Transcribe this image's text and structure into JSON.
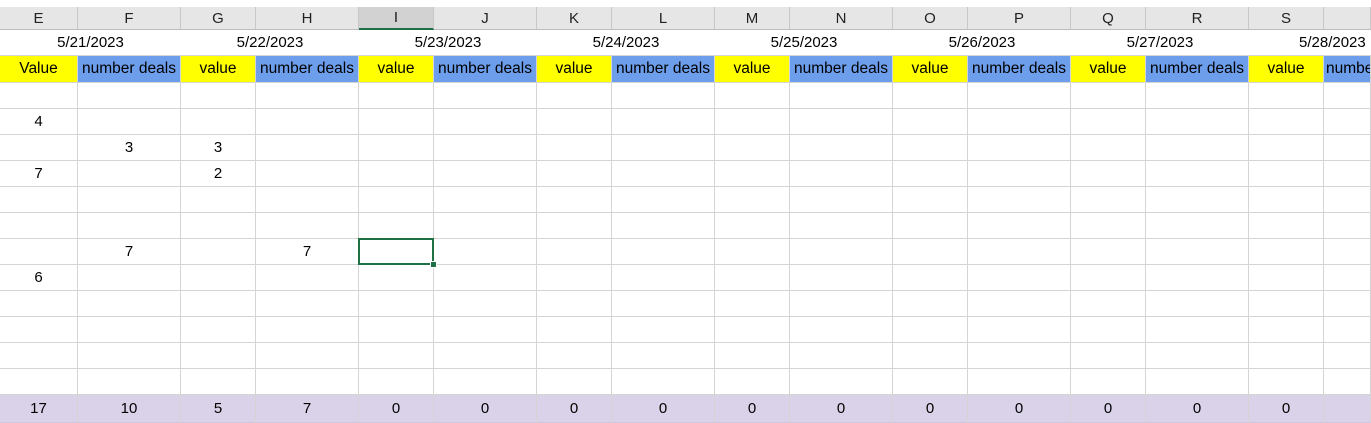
{
  "columns": [
    "E",
    "F",
    "G",
    "H",
    "I",
    "J",
    "K",
    "L",
    "M",
    "N",
    "O",
    "P",
    "Q",
    "R",
    "S",
    ""
  ],
  "active_column": "I",
  "dates": [
    "5/21/2023",
    "5/22/2023",
    "5/23/2023",
    "5/24/2023",
    "5/25/2023",
    "5/26/2023",
    "5/27/2023",
    "5/28/2023"
  ],
  "labels": [
    "Value",
    "number deals",
    "value",
    "number deals",
    "value",
    "number deals",
    "value",
    "number deals",
    "value",
    "number deals",
    "value",
    "number deals",
    "value",
    "number deals",
    "value",
    "number deals"
  ],
  "data_rows": [
    [
      "",
      "",
      "",
      "",
      "",
      "",
      "",
      "",
      "",
      "",
      "",
      "",
      "",
      "",
      "",
      ""
    ],
    [
      "4",
      "",
      "",
      "",
      "",
      "",
      "",
      "",
      "",
      "",
      "",
      "",
      "",
      "",
      "",
      ""
    ],
    [
      "",
      "3",
      "3",
      "",
      "",
      "",
      "",
      "",
      "",
      "",
      "",
      "",
      "",
      "",
      "",
      ""
    ],
    [
      "7",
      "",
      "2",
      "",
      "",
      "",
      "",
      "",
      "",
      "",
      "",
      "",
      "",
      "",
      "",
      ""
    ],
    [
      "",
      "",
      "",
      "",
      "",
      "",
      "",
      "",
      "",
      "",
      "",
      "",
      "",
      "",
      "",
      ""
    ],
    [
      "",
      "",
      "",
      "",
      "",
      "",
      "",
      "",
      "",
      "",
      "",
      "",
      "",
      "",
      "",
      ""
    ],
    [
      "",
      "7",
      "",
      "7",
      "",
      "",
      "",
      "",
      "",
      "",
      "",
      "",
      "",
      "",
      "",
      ""
    ],
    [
      "6",
      "",
      "",
      "",
      "",
      "",
      "",
      "",
      "",
      "",
      "",
      "",
      "",
      "",
      "",
      ""
    ],
    [
      "",
      "",
      "",
      "",
      "",
      "",
      "",
      "",
      "",
      "",
      "",
      "",
      "",
      "",
      "",
      ""
    ],
    [
      "",
      "",
      "",
      "",
      "",
      "",
      "",
      "",
      "",
      "",
      "",
      "",
      "",
      "",
      "",
      ""
    ],
    [
      "",
      "",
      "",
      "",
      "",
      "",
      "",
      "",
      "",
      "",
      "",
      "",
      "",
      "",
      "",
      ""
    ],
    [
      "",
      "",
      "",
      "",
      "",
      "",
      "",
      "",
      "",
      "",
      "",
      "",
      "",
      "",
      "",
      ""
    ]
  ],
  "totals": [
    "17",
    "10",
    "5",
    "7",
    "0",
    "0",
    "0",
    "0",
    "0",
    "0",
    "0",
    "0",
    "0",
    "0",
    "0",
    ""
  ],
  "colors": {
    "value_label_bg": "#ffff00",
    "deals_label_bg": "#6d9eeb",
    "totals_bg": "#d9d2e9",
    "selection": "#1e7145"
  }
}
